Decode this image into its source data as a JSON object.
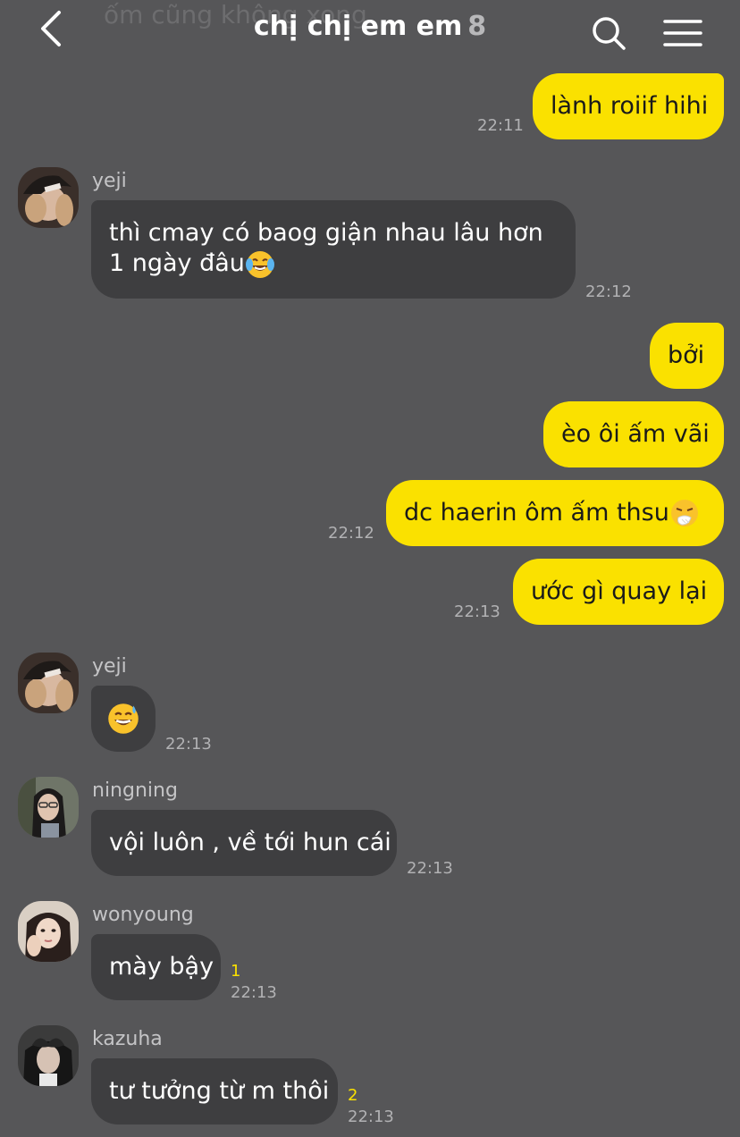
{
  "header": {
    "ghost_preview": "ốm cũng không xong",
    "title": "chị chị em em",
    "member_count": "8"
  },
  "messages": {
    "m1": {
      "text": "lành roiif hihi",
      "time": "22:11"
    },
    "m2": {
      "sender": "yeji",
      "text": "thì cmay có baog giận nhau lâu hơn 1 ngày đâu",
      "emoji": "face-with-tears-of-joy-icon",
      "time": "22:12"
    },
    "m3": {
      "text": "bởi"
    },
    "m4": {
      "text": "èo ôi ấm vãi"
    },
    "m5": {
      "text": "dc haerin ôm ấm thsu",
      "emoji": "sneezing-face-icon",
      "time": "22:12"
    },
    "m6": {
      "text": "ước gì quay lại",
      "time": "22:13"
    },
    "m7": {
      "sender": "yeji",
      "emoji": "grinning-face-with-sweat-icon",
      "time": "22:13"
    },
    "m8": {
      "sender": "ningning",
      "text": "vội luôn , về tới hun cái",
      "time": "22:13"
    },
    "m9": {
      "sender": "wonyoung",
      "text": "mày bậy",
      "unread": "1",
      "time": "22:13"
    },
    "m10": {
      "sender": "kazuha",
      "text": "tư tưởng từ m thôi",
      "unread": "2",
      "time": "22:13"
    }
  },
  "colors": {
    "background": "#565658",
    "my_bubble": "#fae100",
    "their_bubble": "#3e3e40",
    "unread_count": "#fae100"
  }
}
